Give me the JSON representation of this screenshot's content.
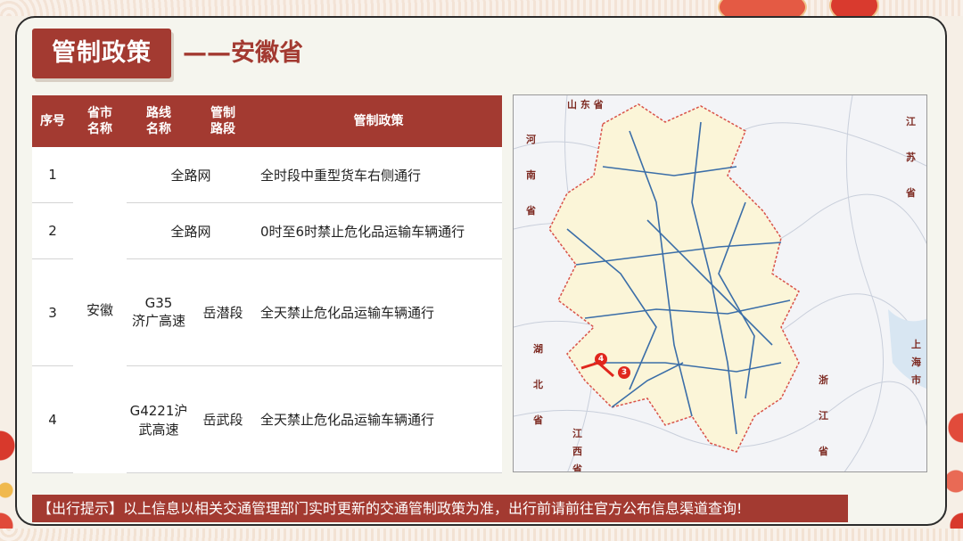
{
  "header": {
    "title": "管制政策",
    "subtitle": "——安徽省"
  },
  "table": {
    "headers": {
      "index": [
        "序号"
      ],
      "province": [
        "省市",
        "名称"
      ],
      "route": [
        "路线",
        "名称"
      ],
      "section": [
        "管制",
        "路段"
      ],
      "policy": [
        "管制政策"
      ]
    },
    "province_value": "安徽",
    "rows": [
      {
        "index": "1",
        "route": [
          "全路网"
        ],
        "section": "",
        "policy": "全时段中重型货车右侧通行"
      },
      {
        "index": "2",
        "route": [
          "全路网"
        ],
        "section": "",
        "policy": "0时至6时禁止危化品运输车辆通行"
      },
      {
        "index": "3",
        "route": [
          "G35",
          "济广高速"
        ],
        "section": "岳潜段",
        "policy": "全天禁止危化品运输车辆通行"
      },
      {
        "index": "4",
        "route": [
          "G4221沪",
          "武高速"
        ],
        "section": "岳武段",
        "policy": "全天禁止危化品运输车辆通行"
      }
    ]
  },
  "map": {
    "labels": {
      "shandong": "山 东 省",
      "henan": "河 南 省",
      "jiangsu": "江 苏 省",
      "hubei": "湖 北 省",
      "zhejiang": "浙 江 省",
      "jiangxi": "江 西 省",
      "shanghai": "上 海 市"
    },
    "markers": [
      "4",
      "3"
    ]
  },
  "footer": {
    "tip": "【出行提示】以上信息以相关交通管理部门实时更新的交通管制政策为准，出行前请前往官方公布信息渠道查询!"
  },
  "colors": {
    "accent": "#a33a31",
    "marker": "#e0261d",
    "map_fill": "#fbf5d8",
    "highway": "#3b6ea8"
  }
}
